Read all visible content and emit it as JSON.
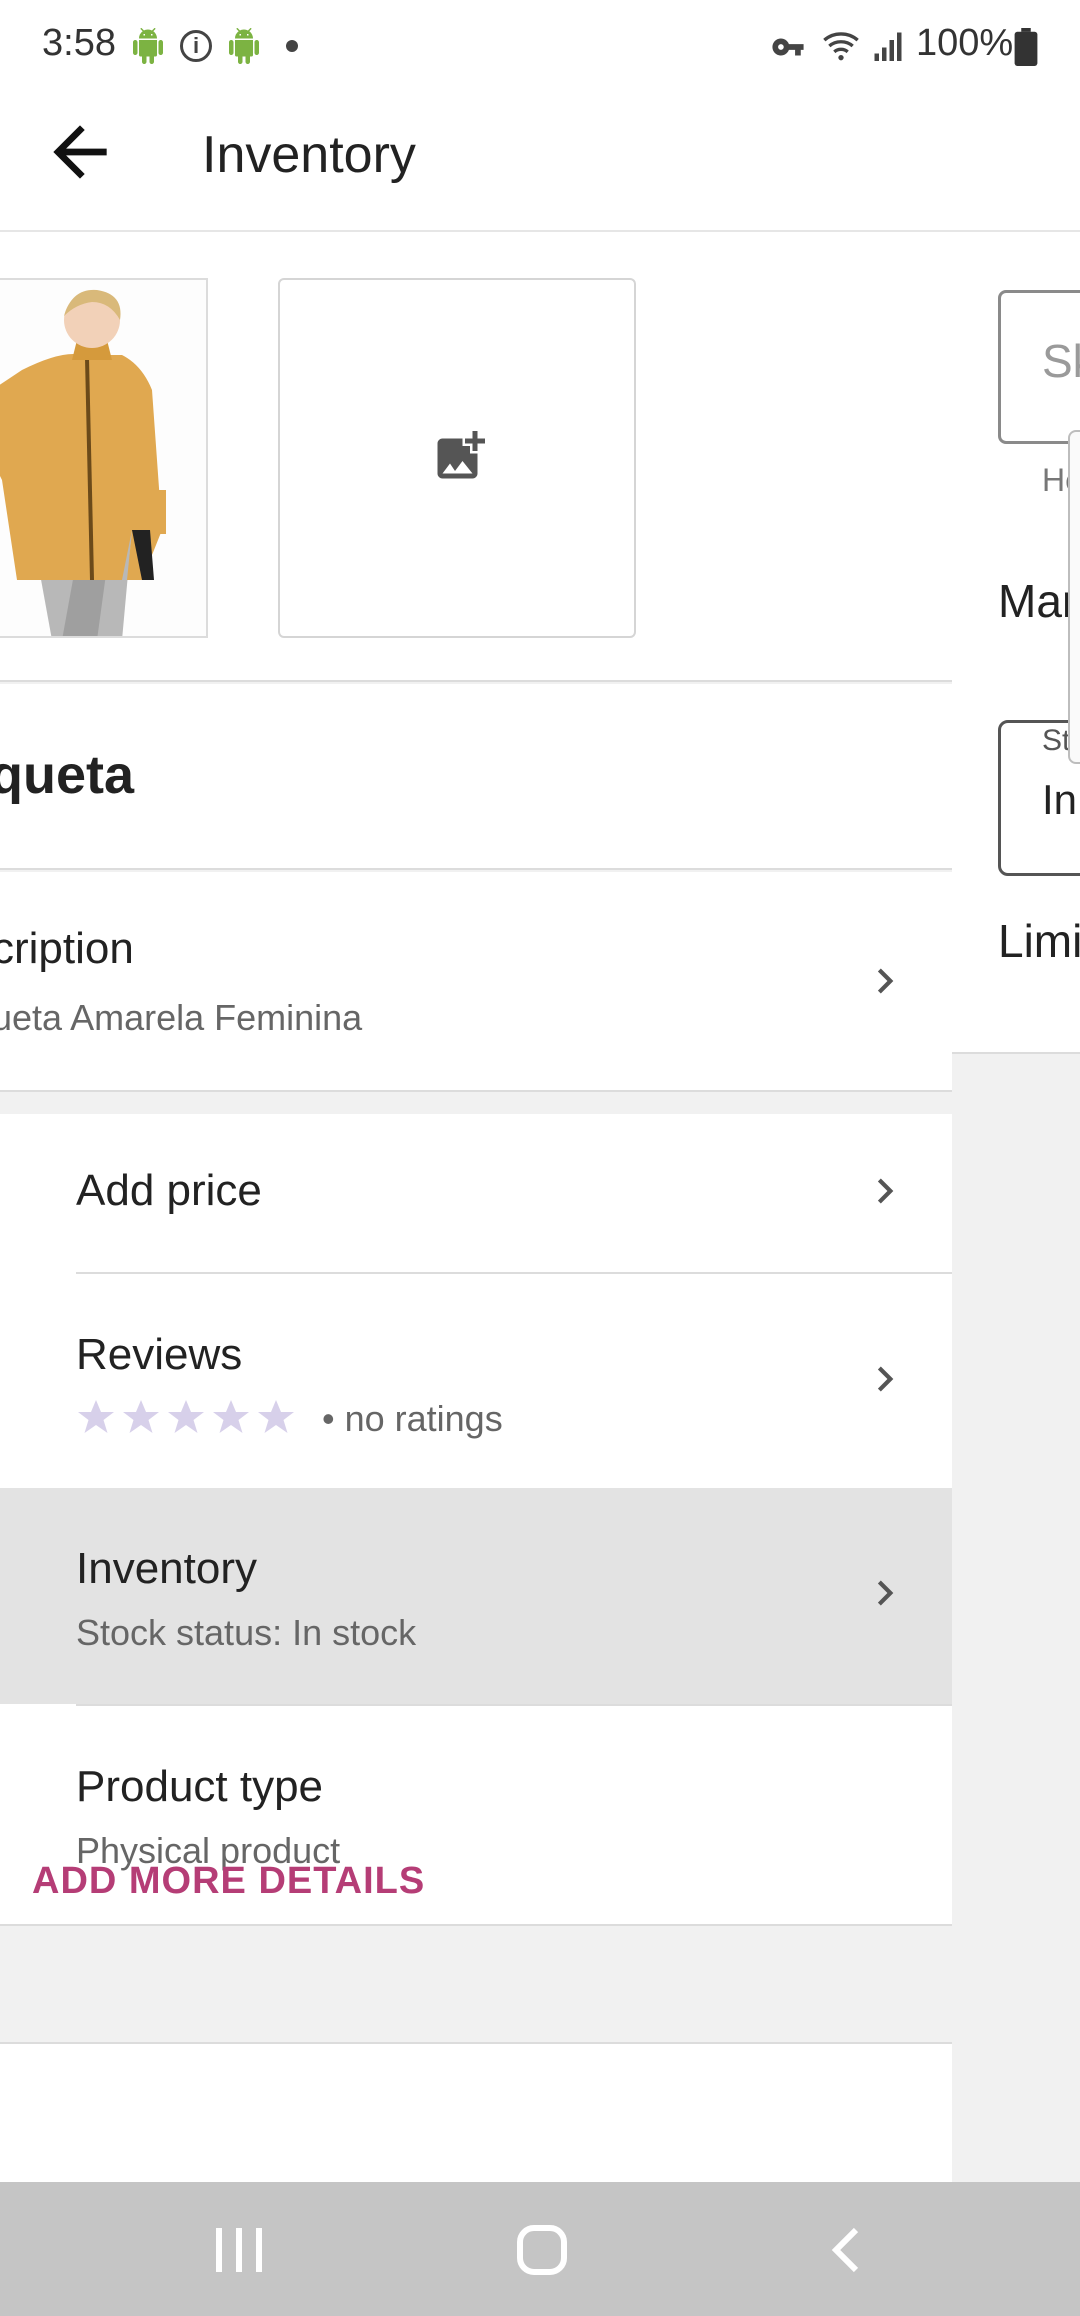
{
  "status_bar": {
    "time": "3:58",
    "battery": "100%",
    "icons": [
      "android-icon",
      "android-icon",
      "info-icon",
      "dot-icon",
      "vpn-key-icon",
      "wifi-icon",
      "signal-icon",
      "battery-icon"
    ]
  },
  "app_bar": {
    "title": "Inventory",
    "back_icon": "arrow-back-icon"
  },
  "product": {
    "title_partial": "queta",
    "description_label_partial": "cription",
    "description_value_partial": "ueta Amarela Feminina",
    "add_image_icon": "add-photo-icon"
  },
  "list": {
    "add_price": "Add price",
    "reviews_label": "Reviews",
    "reviews_sub": "• no ratings",
    "stars": 0,
    "inventory_label": "Inventory",
    "inventory_sub": "Stock status: In stock",
    "product_type_label": "Product type",
    "product_type_sub": "Physical product"
  },
  "footer": {
    "add_more": "ADD MORE DETAILS"
  },
  "right_screen": {
    "sku_placeholder": "Sk",
    "sku_helper": "He",
    "manage_label": "Man",
    "stock_field_label": "St",
    "stock_field_value": "In",
    "limit_label": "Limi"
  },
  "colors": {
    "accent": "#b53d76",
    "selected_row": "#e3e3e3",
    "star_empty": "#d7d0ea"
  },
  "nav_bar": {
    "icons": [
      "recent-apps-icon",
      "home-icon",
      "back-nav-icon"
    ]
  }
}
